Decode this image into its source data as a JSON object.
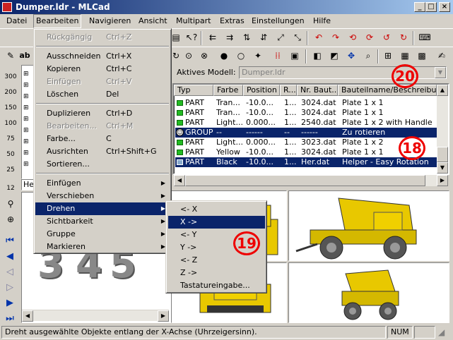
{
  "window": {
    "title": "Dumper.ldr - MLCad",
    "minimize": "_",
    "maximize": "□",
    "close": "×"
  },
  "menubar": [
    "Datei",
    "Bearbeiten",
    "Navigieren",
    "Ansicht",
    "Multipart",
    "Extras",
    "Einstellungen",
    "Hilfe"
  ],
  "edit_menu": [
    {
      "label": "Rückgängig",
      "shortcut": "Ctrl+Z",
      "disabled": true
    },
    {
      "label": "Ausschneiden",
      "shortcut": "Ctrl+X"
    },
    {
      "label": "Kopieren",
      "shortcut": "Ctrl+C"
    },
    {
      "label": "Einfügen",
      "shortcut": "Ctrl+V",
      "disabled": true
    },
    {
      "label": "Löschen",
      "shortcut": "Del"
    },
    {
      "label": "Duplizieren",
      "shortcut": "Ctrl+D"
    },
    {
      "label": "Bearbeiten...",
      "shortcut": "Ctrl+M",
      "disabled": true
    },
    {
      "label": "Farbe...",
      "shortcut": "C"
    },
    {
      "label": "Ausrichten",
      "shortcut": "Ctrl+Shift+G"
    },
    {
      "label": "Sortieren...",
      "shortcut": ""
    },
    {
      "label": "Einfügen",
      "shortcut": ""
    },
    {
      "label": "Verschieben",
      "shortcut": ""
    },
    {
      "label": "Drehen",
      "shortcut": ""
    },
    {
      "label": "Sichtbarkeit",
      "shortcut": ""
    },
    {
      "label": "Gruppe",
      "shortcut": ""
    },
    {
      "label": "Markieren",
      "shortcut": ""
    }
  ],
  "rotate_submenu": [
    "<- X",
    "X ->",
    "<- Y",
    "Y ->",
    "<- Z",
    "Z ->",
    "Tastatureingabe..."
  ],
  "model": {
    "label": "Aktives Modell:",
    "value": "Dumper.ldr"
  },
  "parts_list": {
    "columns": [
      "Typ",
      "Farbe",
      "Position",
      "R...",
      "Nr. Baut...",
      "Bauteilname/Beschreibung"
    ],
    "rows": [
      [
        "PART",
        "Tran...",
        "-10.0...",
        "1...",
        "3024.dat",
        "Plate 1 x 1"
      ],
      [
        "PART",
        "Tran...",
        "-10.0...",
        "1...",
        "3024.dat",
        "Plate 1 x 1"
      ],
      [
        "PART",
        "Light...",
        "0.000...",
        "1...",
        "2540.dat",
        "Plate 1 x 2 with Handle"
      ],
      [
        "GROUP",
        "--",
        "------",
        "--",
        "------",
        "Zu rotieren"
      ],
      [
        "PART",
        "Light...",
        "0.000...",
        "1...",
        "3023.dat",
        "Plate 1 x 2"
      ],
      [
        "PART",
        "Yellow",
        "-10.0...",
        "1...",
        "3024.dat",
        "Plate 1 x 1"
      ],
      [
        "PART",
        "Black",
        "-10.0...",
        "1...",
        "Her.dat",
        "Helper - Easy Rotation"
      ]
    ]
  },
  "left_panel": {
    "scale_labels": [
      "300",
      "200",
      "150",
      "100",
      "75",
      "50",
      "25",
      "12"
    ],
    "tree_label": "He",
    "digits": [
      "3",
      "4",
      "5"
    ]
  },
  "callouts": [
    "20",
    "18",
    "19"
  ],
  "status": {
    "text": "Dreht ausgewählte Objekte entlang der X-Achse (Uhrzeigersinn).",
    "num": "NUM"
  },
  "colors": {
    "titlebar": "#0a246a",
    "selection": "#0a246a",
    "callout": "#ee0000",
    "part_icon": "#22bb22",
    "lego_yellow": "#f0d000"
  }
}
